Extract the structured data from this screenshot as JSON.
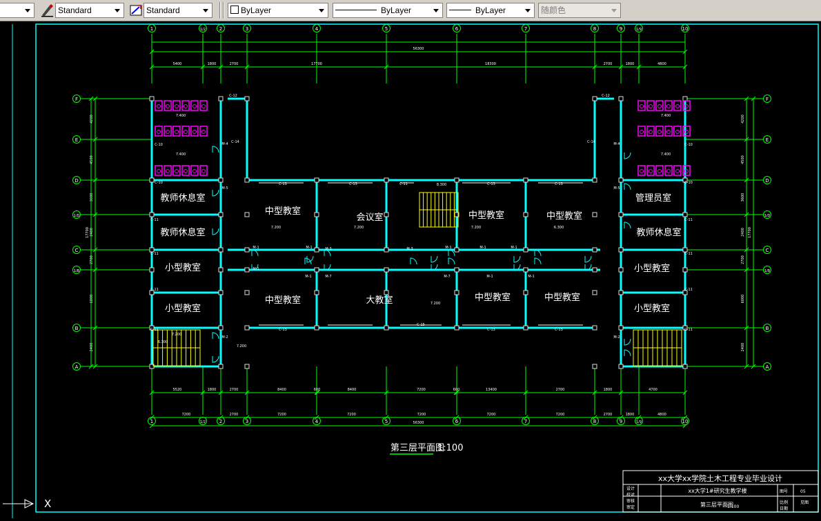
{
  "toolbar": {
    "text_style": "Standard",
    "dim_style": "Standard",
    "layer": "ByLayer",
    "linetype": "ByLayer",
    "lineweight": "ByLayer",
    "plot_style": "随颜色"
  },
  "drawing": {
    "plan_title": "第三层平面图",
    "scale": "1:100",
    "rooms": [
      {
        "id": "teacher-lounge-1",
        "label": "教师休息室"
      },
      {
        "id": "teacher-lounge-2",
        "label": "教师休息室"
      },
      {
        "id": "small-classroom-1",
        "label": "小型教室"
      },
      {
        "id": "small-classroom-2",
        "label": "小型教室"
      },
      {
        "id": "medium-classroom-1",
        "label": "中型教室"
      },
      {
        "id": "meeting-room",
        "label": "会议室"
      },
      {
        "id": "medium-classroom-2",
        "label": "中型教室"
      },
      {
        "id": "medium-classroom-3",
        "label": "中型教室"
      },
      {
        "id": "medium-classroom-4",
        "label": "中型教室"
      },
      {
        "id": "large-classroom",
        "label": "大教室"
      },
      {
        "id": "medium-classroom-5",
        "label": "中型教室"
      },
      {
        "id": "medium-classroom-6",
        "label": "中型教室"
      },
      {
        "id": "admin-room",
        "label": "管理员室"
      },
      {
        "id": "teacher-lounge-3",
        "label": "教师休息室"
      },
      {
        "id": "small-classroom-3",
        "label": "小型教室"
      },
      {
        "id": "small-classroom-4",
        "label": "小型教室"
      }
    ],
    "axes_columns": [
      "1",
      "1/2",
      "2",
      "3",
      "4",
      "5",
      "6",
      "7",
      "8",
      "9",
      "1/9",
      "10"
    ],
    "axes_rows": [
      "F",
      "E",
      "D",
      "1/D",
      "C",
      "1/B",
      "B",
      "A"
    ],
    "top_dims": [
      "5400",
      "1800",
      "2700",
      "17700",
      "18300",
      "2700",
      "1800",
      "4800"
    ],
    "top_total": "56300",
    "bottom_dims_1": [
      "5520",
      "1800",
      "2700",
      "8400",
      "600",
      "8400",
      "7200",
      "600",
      "13400",
      "2700",
      "1800",
      "4700"
    ],
    "bottom_dims_2": [
      "7200",
      "2700",
      "7200",
      "7200",
      "7200",
      "7200",
      "7200",
      "2700",
      "1800",
      "4800"
    ],
    "bottom_total": "56300",
    "left_dims": [
      "4200",
      "4500",
      "3600",
      "2400",
      "2700",
      "6000",
      "2400"
    ],
    "left_total": "17700",
    "right_dims": [
      "4200",
      "4500",
      "3600",
      "2400",
      "2700",
      "6000",
      "2400"
    ],
    "right_total": "17700",
    "elevations": [
      "7.400",
      "7.400",
      "7.400",
      "7.400",
      "7.200",
      "7.200",
      "7.200",
      "7.200",
      "7.200",
      "7.200",
      "6.300",
      "6.300",
      "8.300"
    ],
    "win_labels": [
      "C-13",
      "C-13",
      "C-12",
      "C-11",
      "C-13",
      "C-13",
      "C-13",
      "C-15",
      "C-13",
      "C-13",
      "C-12",
      "C-10",
      "C-10",
      "C-11",
      "C-11",
      "C-11",
      "C-11",
      "C-10",
      "C-10",
      "C-11",
      "C-11",
      "C-11",
      "C-11",
      "C-14",
      "C-14"
    ],
    "door_labels": [
      "M-3",
      "M-3",
      "M-1",
      "M-1",
      "M-1",
      "M-1",
      "M-1",
      "M-1",
      "M-7",
      "M-7",
      "M-1",
      "M-1",
      "M-1",
      "M-5",
      "M-5",
      "M-4",
      "M-4",
      "M-2",
      "M-2"
    ]
  },
  "title_block": {
    "project": "xx大学xx学院土木工程专业毕业设计",
    "building": "xx大学1#研究生教学楼",
    "sheet_title": "第三层平面图",
    "sheet_scale": "1:100",
    "field_labels": [
      "设计",
      "校对",
      "审核",
      "审定"
    ],
    "sheet_no_label": "图号",
    "sheet_no": "05",
    "ratio_label": "比例",
    "ratio": "见图",
    "date_label": "日期"
  },
  "ucs": {
    "x_label": "X"
  },
  "colors": {
    "background": "#000000",
    "grid_lines": "#00ff00",
    "walls": "#00ffff",
    "text": "#ffffff",
    "fixtures": "#ff00ff",
    "stairs": "#ffff00",
    "frame": "#00ffff"
  }
}
